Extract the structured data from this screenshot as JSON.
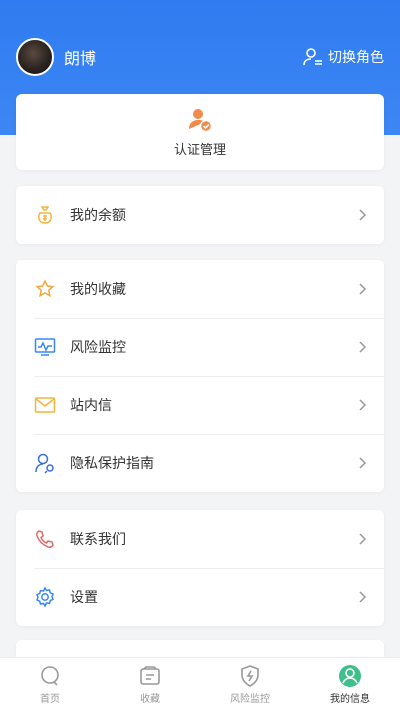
{
  "profile": {
    "name": "朗博"
  },
  "header": {
    "switch_role_label": "切换角色"
  },
  "auth": {
    "label": "认证管理"
  },
  "balance": {
    "label": "我的余额"
  },
  "menu": [
    {
      "label": "我的收藏",
      "icon": "star-icon"
    },
    {
      "label": "风险监控",
      "icon": "monitor-icon"
    },
    {
      "label": "站内信",
      "icon": "mail-icon"
    },
    {
      "label": "隐私保护指南",
      "icon": "privacy-user-icon"
    }
  ],
  "menu2": [
    {
      "label": "联系我们",
      "icon": "phone-icon"
    },
    {
      "label": "设置",
      "icon": "gear-icon"
    }
  ],
  "tabs": [
    {
      "label": "首页",
      "icon": "search-icon"
    },
    {
      "label": "收藏",
      "icon": "collect-icon"
    },
    {
      "label": "风险监控",
      "icon": "shield-icon"
    },
    {
      "label": "我的信息",
      "icon": "user-icon",
      "active": true
    }
  ],
  "colors": {
    "primary": "#2f7cf0",
    "auth_icon": "#f28a4b",
    "balance_icon": "#f5b342",
    "mail_icon": "#f5b342",
    "phone_icon": "#e06a6a",
    "gear_icon": "#3a86f5",
    "tab_active": "#3fbf8b"
  }
}
